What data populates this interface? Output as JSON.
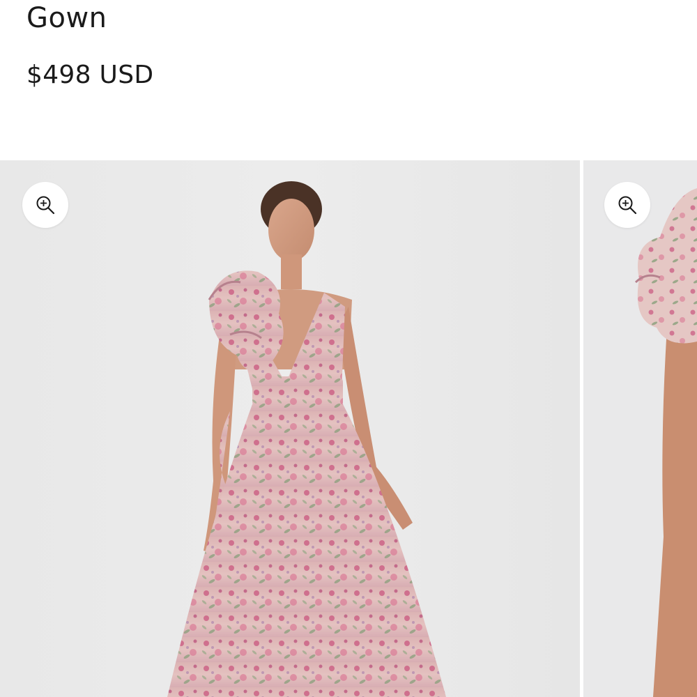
{
  "product": {
    "title": "Gown",
    "price": "$498 USD"
  },
  "gallery": {
    "images": [
      {
        "alt": "floral-ruffle-gown-front-view",
        "zoom_icon": "zoom-in-icon"
      },
      {
        "alt": "floral-ruffle-gown-shoulder-detail",
        "zoom_icon": "zoom-in-icon"
      }
    ]
  },
  "colors": {
    "background": "#ebebeb",
    "text": "#1a1a1a",
    "gown_base": "#e6c5c2",
    "gown_floral_pink": "#c9567f",
    "gown_leaf_green": "#7c9b72"
  }
}
